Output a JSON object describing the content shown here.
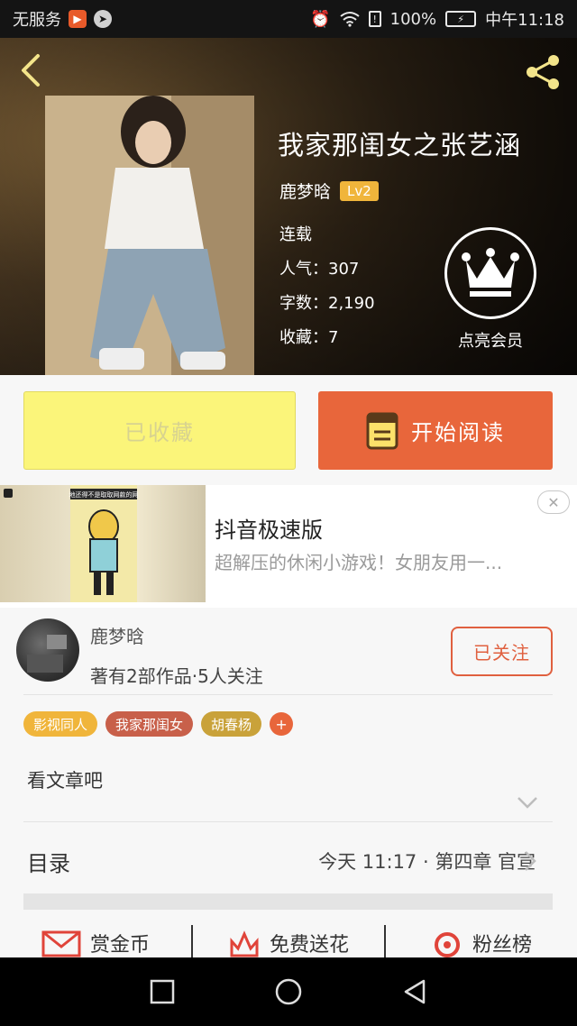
{
  "status_bar": {
    "carrier": "无服务",
    "battery": "100%",
    "time": "中午11:18"
  },
  "book": {
    "title": "我家那闺女之张艺涵",
    "author": "鹿梦晗",
    "level": "Lv2",
    "status": "连载",
    "popularity": "人气：307",
    "word_count": "字数：2,190",
    "favorites": "收藏：7"
  },
  "vip": {
    "label": "点亮会员"
  },
  "actions": {
    "collect_label": "已收藏",
    "read_label": "开始阅读"
  },
  "ad": {
    "title": "抖音极速版",
    "description": "超解压的休闲小游戏！女朋友用一...",
    "close_glyph": "✕",
    "image_caption": "地还得不是取取网款的网"
  },
  "author_section": {
    "name": "鹿梦晗",
    "stats": "著有2部作品·5人关注",
    "follow_label": "已关注",
    "tags": [
      {
        "label": "影视同人",
        "color": "#f0b53b"
      },
      {
        "label": "我家那闺女",
        "color": "#c8604a"
      },
      {
        "label": "胡春杨",
        "color": "#c9a23a"
      }
    ],
    "add_tag_glyph": "+",
    "intro": "看文章吧"
  },
  "toc": {
    "label": "目录",
    "latest": "今天 11:17 · 第四章 官宣"
  },
  "bottom_tabs": [
    {
      "label": "赏金币",
      "icon": "envelope-icon"
    },
    {
      "label": "免费送花",
      "icon": "flower-icon"
    },
    {
      "label": "粉丝榜",
      "icon": "ring-icon"
    }
  ],
  "colors": {
    "accent": "#e8663b",
    "collect_bg": "#fbf57a",
    "badge": "#f0b53b"
  }
}
